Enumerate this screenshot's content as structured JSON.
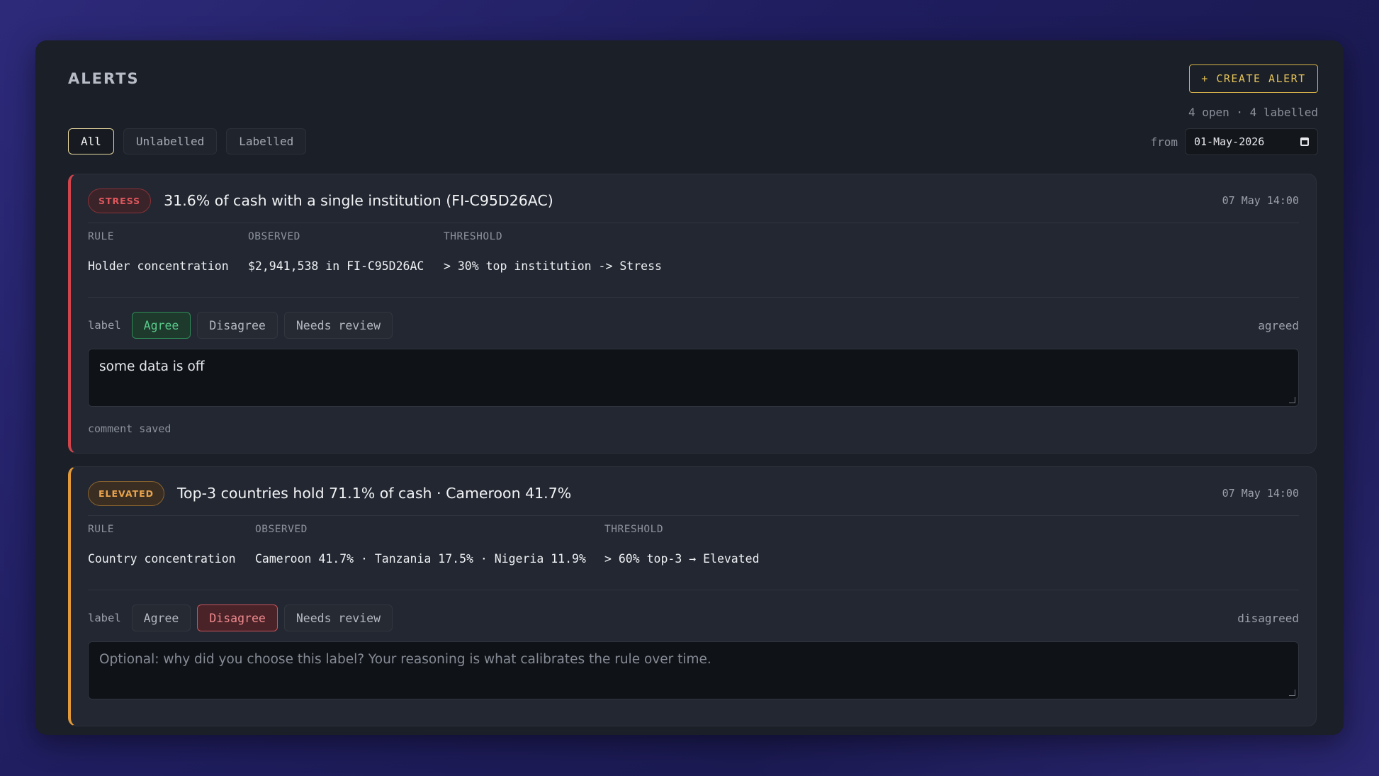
{
  "header": {
    "title": "ALERTS",
    "create_label": "+ CREATE ALERT",
    "summary": "4 open · 4 labelled"
  },
  "filters": {
    "items": [
      "All",
      "Unlabelled",
      "Labelled"
    ],
    "active": "All"
  },
  "date_filter": {
    "label": "from",
    "value": "01-May-2026"
  },
  "alerts": [
    {
      "severity": "STRESS",
      "title": "31.6% of cash with a single institution (FI-C95D26AC)",
      "timestamp": "07 May 14:00",
      "columns": {
        "rule_head": "RULE",
        "observed_head": "OBSERVED",
        "threshold_head": "THRESHOLD"
      },
      "rule": "Holder concentration",
      "observed": "$2,941,538 in FI-C95D26AC",
      "threshold": "> 30% top institution -> Stress",
      "label_text": "label",
      "label_options": [
        "Agree",
        "Disagree",
        "Needs review"
      ],
      "selected": "Agree",
      "status": "agreed",
      "comment": "some data is off",
      "comment_status": "comment saved",
      "accent_color": "#d0454c"
    },
    {
      "severity": "ELEVATED",
      "title": "Top-3 countries hold 71.1% of cash · Cameroon 41.7%",
      "timestamp": "07 May 14:00",
      "columns": {
        "rule_head": "RULE",
        "observed_head": "OBSERVED",
        "threshold_head": "THRESHOLD"
      },
      "rule": "Country concentration",
      "observed": "Cameroon 41.7% · Tanzania 17.5% · Nigeria 11.9%",
      "threshold": "> 60% top-3 → Elevated",
      "label_text": "label",
      "label_options": [
        "Agree",
        "Disagree",
        "Needs review"
      ],
      "selected": "Disagree",
      "status": "disagreed",
      "comment_placeholder": "Optional: why did you choose this label? Your reasoning is what calibrates the rule over time.",
      "accent_color": "#e2993a"
    }
  ]
}
